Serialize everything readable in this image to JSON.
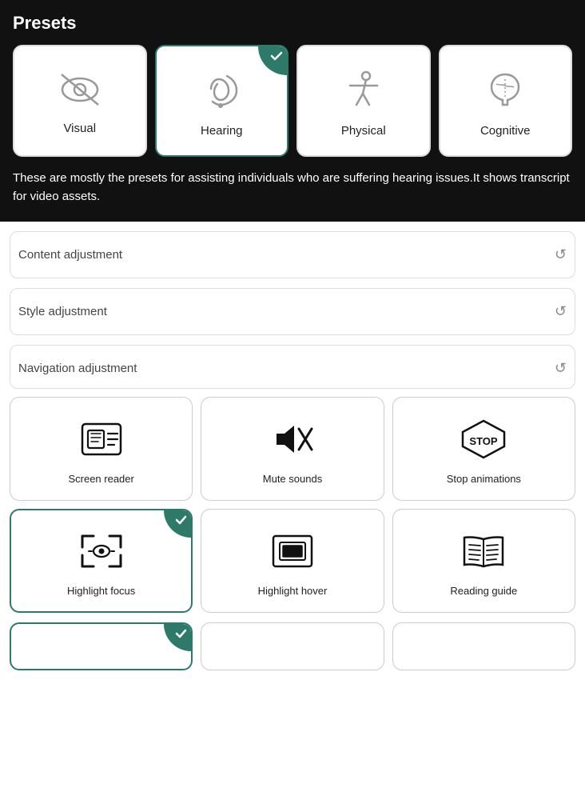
{
  "presets": {
    "title": "Presets",
    "cards": [
      {
        "id": "visual",
        "label": "Visual",
        "active": false
      },
      {
        "id": "hearing",
        "label": "Hearing",
        "active": true
      },
      {
        "id": "physical",
        "label": "Physical",
        "active": false
      },
      {
        "id": "cognitive",
        "label": "Cognitive",
        "active": false
      }
    ],
    "description": "These are mostly the presets for assisting individuals who are suffering hearing issues.It shows transcript for video assets."
  },
  "adjustments": {
    "content": {
      "label": "Content adjustment"
    },
    "style": {
      "label": "Style adjustment"
    },
    "navigation": {
      "label": "Navigation adjustment"
    }
  },
  "navCards": [
    {
      "id": "screen-reader",
      "label": "Screen reader",
      "active": false
    },
    {
      "id": "mute-sounds",
      "label": "Mute sounds",
      "active": false
    },
    {
      "id": "stop-animations",
      "label": "Stop animations",
      "active": false
    },
    {
      "id": "highlight-focus",
      "label": "Highlight focus",
      "active": true
    },
    {
      "id": "highlight-hover",
      "label": "Highlight hover",
      "active": false
    },
    {
      "id": "reading-guide",
      "label": "Reading guide",
      "active": false
    }
  ],
  "bottomPartialCards": [
    {
      "id": "bottom-1",
      "label": "",
      "active": true
    }
  ],
  "colors": {
    "accent": "#2d7a6b",
    "border_active": "#2d7a6b"
  }
}
